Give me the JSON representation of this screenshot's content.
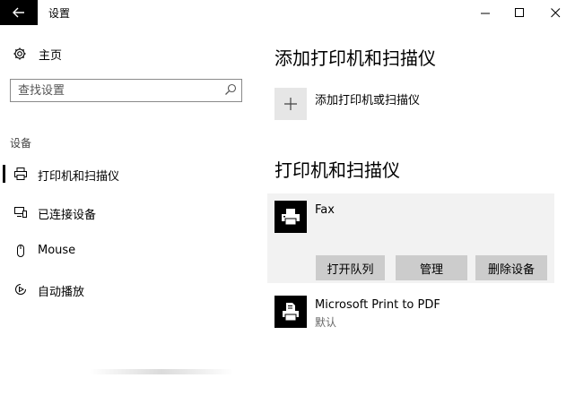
{
  "window": {
    "title": "设置",
    "controls": {
      "minimize_icon": "minimize-icon",
      "maximize_icon": "maximize-icon",
      "close_icon": "close-icon"
    }
  },
  "sidebar": {
    "home_label": "主页",
    "search": {
      "placeholder": "查找设置",
      "value": ""
    },
    "section_header": "设备",
    "items": [
      {
        "label": "打印机和扫描仪",
        "icon": "printer-icon",
        "selected": true
      },
      {
        "label": "已连接设备",
        "icon": "connected-devices-icon",
        "selected": false
      },
      {
        "label": "Mouse",
        "icon": "mouse-icon",
        "selected": false
      },
      {
        "label": "自动播放",
        "icon": "autoplay-icon",
        "selected": false
      }
    ]
  },
  "main": {
    "add_heading": "添加打印机和扫描仪",
    "add_button_label": "添加打印机或扫描仪",
    "printers_heading": "打印机和扫描仪",
    "printers": [
      {
        "name": "Fax",
        "status": "",
        "expanded": true,
        "icon": "fax-printer-icon"
      },
      {
        "name": "Microsoft Print to PDF",
        "status": "默认",
        "expanded": false,
        "icon": "pdf-printer-icon"
      }
    ],
    "actions": {
      "open_queue": "打开队列",
      "manage": "管理",
      "remove_device": "删除设备"
    }
  },
  "colors": {
    "accent_black": "#000000",
    "panel_gray": "#f2f2f2",
    "button_gray": "#cccccc",
    "tile_gray": "#e6e6e6"
  }
}
